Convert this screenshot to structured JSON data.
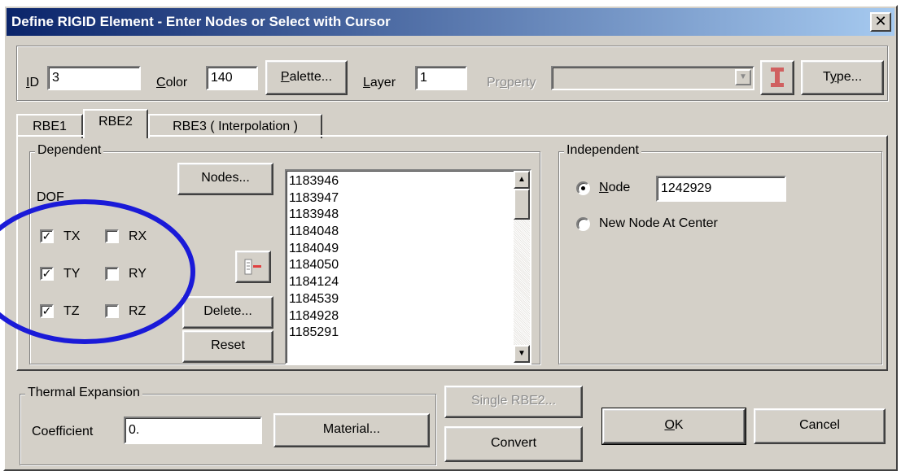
{
  "window": {
    "title": "Define RIGID Element - Enter Nodes or Select with Cursor",
    "close_glyph": "✕"
  },
  "top": {
    "id_label": "ID",
    "id_value": "3",
    "color_label": "Color",
    "color_value": "140",
    "palette_button": "Palette...",
    "layer_label": "Layer",
    "layer_value": "1",
    "property_label": "Property",
    "property_value": "",
    "type_button": "Type...",
    "property_icon": "i-beam-icon"
  },
  "tabs": [
    {
      "label": "RBE1",
      "active": false
    },
    {
      "label": "RBE2",
      "active": true
    },
    {
      "label": "RBE3 ( Interpolation )",
      "active": false
    }
  ],
  "dependent": {
    "title": "Dependent",
    "dof_label": "DOF",
    "nodes_button": "Nodes...",
    "delete_button": "Delete...",
    "reset_button": "Reset",
    "remove_icon": "remove-item-icon",
    "checkboxes": [
      {
        "label": "TX",
        "checked": true
      },
      {
        "label": "RX",
        "checked": false
      },
      {
        "label": "TY",
        "checked": true
      },
      {
        "label": "RY",
        "checked": false
      },
      {
        "label": "TZ",
        "checked": true
      },
      {
        "label": "RZ",
        "checked": false
      }
    ],
    "node_list": [
      "1183946",
      "1183947",
      "1183948",
      "1184048",
      "1184049",
      "1184050",
      "1184124",
      "1184539",
      "1184928",
      "1185291"
    ]
  },
  "independent": {
    "title": "Independent",
    "node_radio_label": "Node",
    "node_value": "1242929",
    "new_node_label": "New Node At Center",
    "selected": "Node"
  },
  "thermal": {
    "title": "Thermal Expansion",
    "coefficient_label": "Coefficient",
    "coefficient_value": "0.",
    "material_button": "Material..."
  },
  "actions": {
    "single_rbe2_button": "Single RBE2...",
    "convert_button": "Convert",
    "ok_button": "OK",
    "cancel_button": "Cancel"
  },
  "annotation": {
    "ellipse_color": "#1a1ad8"
  },
  "colors": {
    "dialog_bg": "#d4d0c8",
    "title_start": "#0a246a",
    "title_end": "#a6caf0"
  }
}
